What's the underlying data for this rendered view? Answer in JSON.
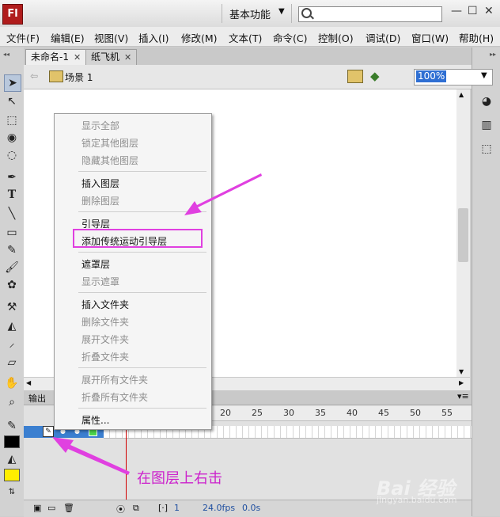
{
  "titlebar": {
    "app_logo": "Fl",
    "workspace": "基本功能",
    "search_placeholder": "",
    "min_icon": "minimize-icon",
    "max_icon": "maximize-icon",
    "close_icon": "close-icon"
  },
  "menubar": {
    "items": [
      "文件(F)",
      "编辑(E)",
      "视图(V)",
      "插入(I)",
      "修改(M)",
      "文本(T)",
      "命令(C)",
      "控制(O)",
      "调试(D)",
      "窗口(W)",
      "帮助(H)"
    ]
  },
  "tabs": [
    {
      "label": "未命名-1",
      "active": true
    },
    {
      "label": "纸飞机",
      "active": false
    }
  ],
  "scenebar": {
    "scene_label": "场景 1",
    "zoom": "100%"
  },
  "timeline": {
    "panel_tab": "输出",
    "frame_numbers": [
      "20",
      "25",
      "30",
      "35",
      "40",
      "45",
      "50",
      "55"
    ],
    "status": {
      "current_frame": "1",
      "fps": "24.0fps",
      "time": "0.0s"
    }
  },
  "context_menu": {
    "groups": [
      [
        {
          "label": "显示全部",
          "enabled": false
        },
        {
          "label": "锁定其他图层",
          "enabled": false
        },
        {
          "label": "隐藏其他图层",
          "enabled": false
        }
      ],
      [
        {
          "label": "插入图层",
          "enabled": true
        },
        {
          "label": "删除图层",
          "enabled": false
        }
      ],
      [
        {
          "label": "引导层",
          "enabled": true
        },
        {
          "label": "添加传统运动引导层",
          "enabled": true
        }
      ],
      [
        {
          "label": "遮罩层",
          "enabled": true
        },
        {
          "label": "显示遮罩",
          "enabled": false
        }
      ],
      [
        {
          "label": "插入文件夹",
          "enabled": true
        },
        {
          "label": "删除文件夹",
          "enabled": false
        },
        {
          "label": "展开文件夹",
          "enabled": false
        },
        {
          "label": "折叠文件夹",
          "enabled": false
        }
      ],
      [
        {
          "label": "展开所有文件夹",
          "enabled": false
        },
        {
          "label": "折叠所有文件夹",
          "enabled": false
        }
      ],
      [
        {
          "label": "属性...",
          "enabled": true
        }
      ]
    ]
  },
  "annotation": {
    "text": "在图层上右击",
    "color": "#cc22cc"
  },
  "watermark": {
    "text": "Bai  经验",
    "sub": "jingyan.baidu.com"
  },
  "colors": {
    "highlight": "#e040e0",
    "arrow": "#e040e0",
    "selected_layer": "#3b7fd0",
    "stroke_swatch": "#000000",
    "fill_swatch": "#ffee00"
  }
}
